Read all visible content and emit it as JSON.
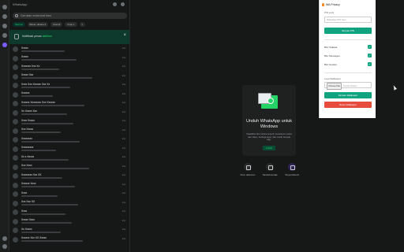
{
  "sidebar": {
    "header_title": "WhatsApp",
    "search_placeholder": "Cari atau mulai chat baru",
    "filters": [
      "Semua",
      "Belum dibaca 3",
      "Favorit",
      "Grup 1",
      "v"
    ],
    "notification": {
      "text": "Notifikasi pesan ",
      "link": "aktifkan"
    },
    "chats": [
      {
        "name": "Xxxxx",
        "time": "xxx"
      },
      {
        "name": "Xxxxx",
        "time": "xxx"
      },
      {
        "name": "Xxxxxxx Xxx Xx",
        "time": "xxx"
      },
      {
        "name": "Xxxxx Xxx",
        "time": "xxx"
      },
      {
        "name": "Xxxx Xxx Xxxxxx Xxx Xx",
        "time": "xxx"
      },
      {
        "name": "Xxxxxx",
        "time": "xxx"
      },
      {
        "name": "Xxxxxx Xxxxxxxx Xxx Xxxxxx",
        "time": "xxx"
      },
      {
        "name": "Xx Xxxxx Xxx",
        "time": "xxx"
      },
      {
        "name": "Xxxx Xxxxx",
        "time": "xxx"
      },
      {
        "name": "Xxx Xxxxx",
        "time": "xxx"
      },
      {
        "name": "Xxxxxxxx",
        "time": "xxx"
      },
      {
        "name": "Xxxxxxxxx",
        "time": "xxx"
      },
      {
        "name": "Xx x Xxxxx",
        "time": "xxx"
      },
      {
        "name": "Xxx Xxxx",
        "time": "xxx"
      },
      {
        "name": "Xxxxxxxx Xxx XX",
        "time": "xxx"
      },
      {
        "name": "Xxxxxx Xxxx",
        "time": "xxx"
      },
      {
        "name": "Xxxx",
        "time": "xxx"
      },
      {
        "name": "Xxx Xxx XX",
        "time": "xxx"
      },
      {
        "name": "Xxxx",
        "time": "xxx"
      },
      {
        "name": "Xxxxx Xxxx",
        "time": "xxx"
      },
      {
        "name": "Xx Xxxxx",
        "time": "xxx"
      },
      {
        "name": "Xxxxxx Xxx XX Xxxxx",
        "time": "xxx"
      }
    ]
  },
  "main": {
    "title": "Unduh WhatsApp untuk Windows",
    "description": "Dapatkan fitur ekstra seperti menelepon suara dan video, berbagi layar, dan masih banyak lagi.",
    "download_label": "Unduh",
    "actions": [
      "Kirim dokumen",
      "Tambah kontak",
      "Tanya Meta AI"
    ]
  },
  "privacy_panel": {
    "title": "WA Privacy",
    "pin_label": "PIN Lock",
    "pin_placeholder": "Masukkan PIN baru",
    "set_pin_label": "Simpan PIN",
    "options": [
      {
        "label": "Blur Sidebar",
        "checked": true
      },
      {
        "label": "Blur Messages",
        "checked": true
      },
      {
        "label": "Blur Header",
        "checked": true
      }
    ],
    "wallpaper_label": "Load Wallpaper",
    "choose_file_label": "Choose File",
    "no_file_label": "No file chosen",
    "save_wallpaper_label": "Simpan Wallpaper",
    "reset_wallpaper_label": "Reset Wallpaper"
  },
  "colors": {
    "accent": "#25d366",
    "panel_button": "#10a37f",
    "reset_button": "#e74c3c",
    "background": "#161717"
  }
}
